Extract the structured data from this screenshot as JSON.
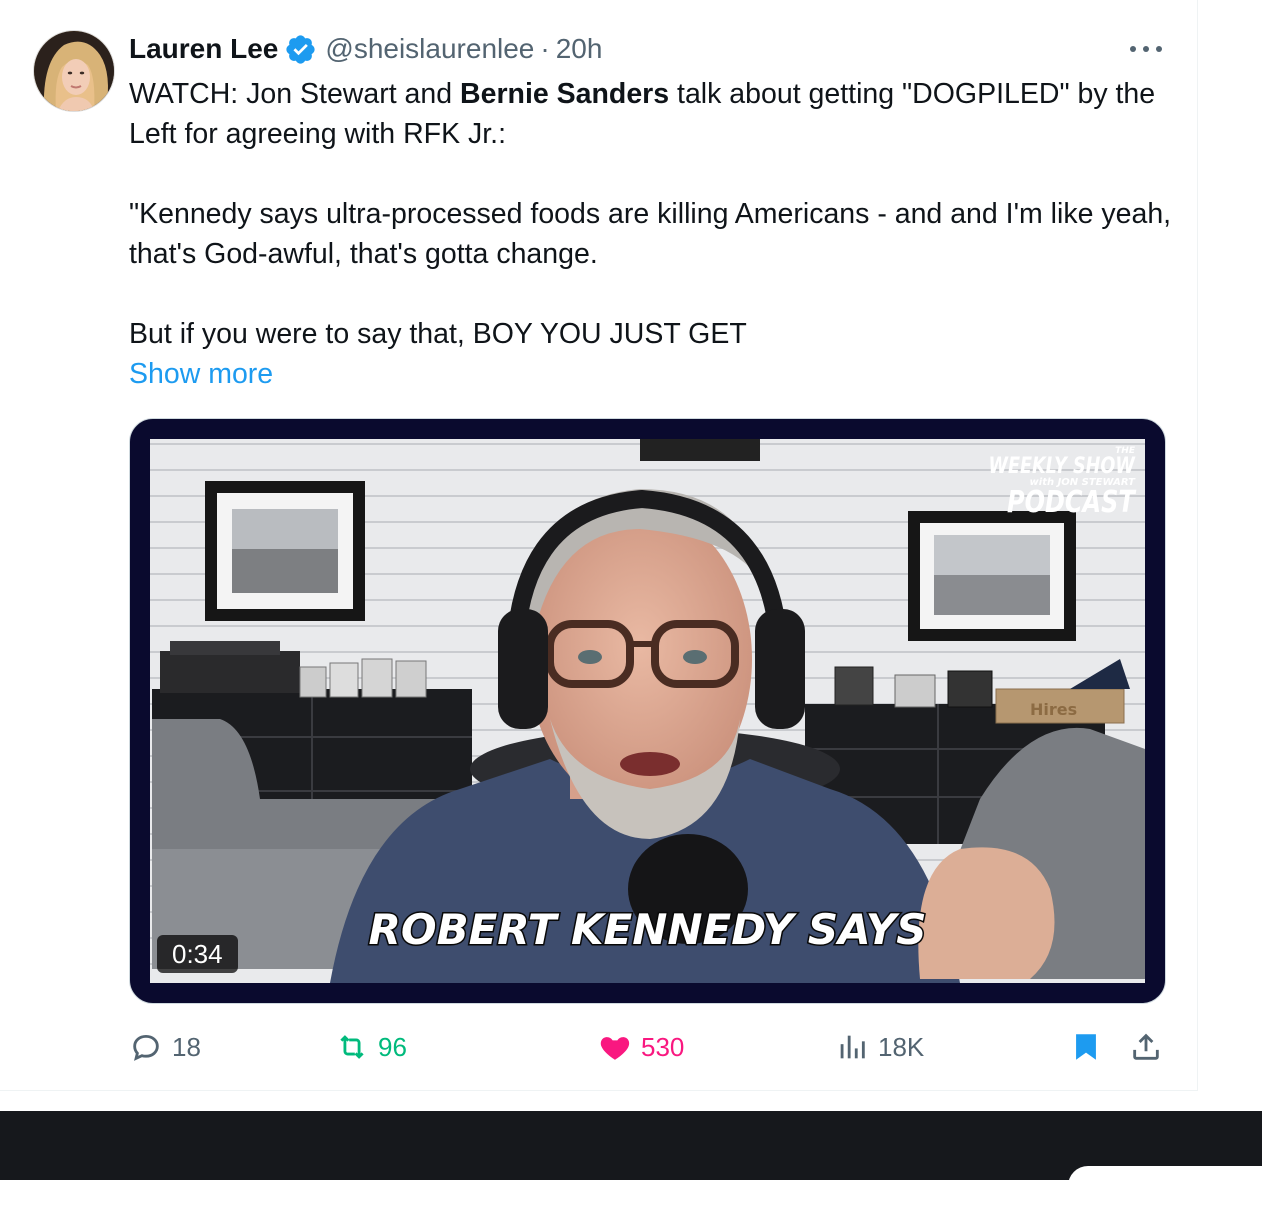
{
  "author": {
    "name": "Lauren Lee",
    "handle": "@sheislaurenlee",
    "separator": "·",
    "time": "20h",
    "verified": true
  },
  "tweet": {
    "line1_pre": "WATCH: Jon Stewart and ",
    "line1_bold": "Bernie Sanders",
    "line1_post": " talk about getting \"DOGPILED\" by the Left for agreeing with RFK Jr.:",
    "para2": "\"Kennedy says ultra-processed foods are killing Americans - and and I'm like yeah, that's God-awful, that's gotta change.",
    "para3": "But if you were to say that, BOY YOU JUST GET",
    "show_more": "Show more"
  },
  "media": {
    "duration": "0:34",
    "caption": "ROBERT KENNEDY SAYS",
    "logo": {
      "small_top": "THE",
      "title": "WEEKLY SHOW",
      "sub": "with JON STEWART",
      "podcast": "PODCAST"
    },
    "crate_label": "Hires"
  },
  "actions": {
    "replies": "18",
    "reposts": "96",
    "likes": "530",
    "views": "18K"
  },
  "colors": {
    "accent": "#1d9bf0",
    "repost": "#00ba7c",
    "like": "#f91880",
    "muted": "#536471"
  },
  "icons": [
    "more-icon",
    "verified-badge-icon",
    "reply-icon",
    "repost-icon",
    "like-icon",
    "views-icon",
    "bookmark-icon",
    "share-icon"
  ]
}
